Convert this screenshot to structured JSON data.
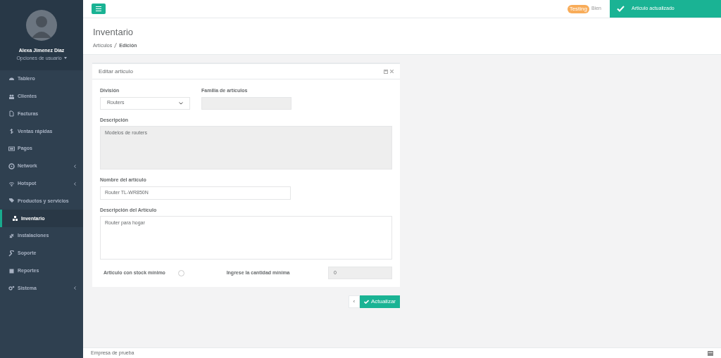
{
  "user": {
    "name": "Alexa Jimenez Díaz",
    "options": "Opciones de usuario"
  },
  "sidebar": {
    "items": [
      {
        "label": "Tablero",
        "selected": false,
        "expandable": false
      },
      {
        "label": "Clientes",
        "selected": false,
        "expandable": false
      },
      {
        "label": "Facturas",
        "selected": false,
        "expandable": false
      },
      {
        "label": "Ventas rápidas",
        "selected": false,
        "expandable": false
      },
      {
        "label": "Pagos",
        "selected": false,
        "expandable": false
      },
      {
        "label": "Network",
        "selected": false,
        "expandable": true
      },
      {
        "label": "Hotspot",
        "selected": false,
        "expandable": true
      },
      {
        "label": "Productos y servicios",
        "selected": false,
        "expandable": false
      },
      {
        "label": "Inventario",
        "selected": true,
        "expandable": false
      },
      {
        "label": "Instalaciones",
        "selected": false,
        "expandable": false
      },
      {
        "label": "Soporte",
        "selected": false,
        "expandable": false
      },
      {
        "label": "Reportes",
        "selected": false,
        "expandable": false
      },
      {
        "label": "Sistema",
        "selected": false,
        "expandable": true
      }
    ]
  },
  "topbar": {
    "badge": "Testing",
    "welcome": "Bien"
  },
  "toast": {
    "message": "Articulo actualizado"
  },
  "page": {
    "title": "Inventario",
    "breadcrumb": [
      {
        "label": "Artículos",
        "current": false
      },
      {
        "label": "Edición",
        "current": true
      }
    ]
  },
  "form": {
    "title": "Editar articulo",
    "division": {
      "label": "División",
      "value": "Routers"
    },
    "familia": {
      "label": "Familia de artículos"
    },
    "descripcion": {
      "label": "Descripción",
      "value": "Modelos de routers"
    },
    "nombre": {
      "label": "Nombre del artículo",
      "value": "Router TL-WR850N"
    },
    "descripcion_articulo": {
      "label": "Descripción del Artículo",
      "value": "Router para hogar"
    },
    "stock_minimo": {
      "label": "Articulo con stock mínimo",
      "checked": false
    },
    "cantidad": {
      "label": "Ingrese la cantidad mínima",
      "value": "0"
    }
  },
  "buttons": {
    "back": "‹",
    "submit": "Actualizar"
  },
  "footer": {
    "text": "Empresa de prueba"
  }
}
